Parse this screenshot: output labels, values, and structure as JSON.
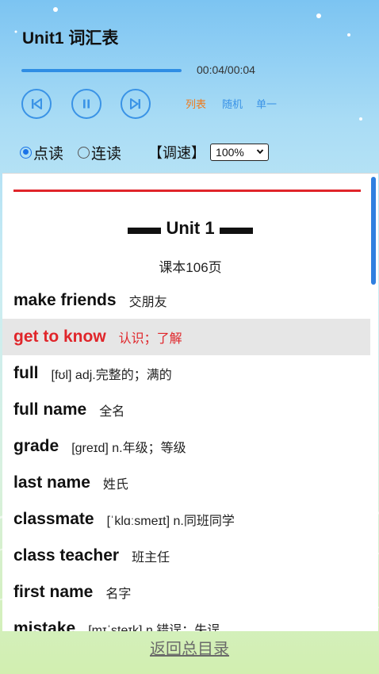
{
  "player": {
    "title": "Unit1 词汇表",
    "time": "00:04/00:04",
    "progress": 1.0,
    "modes": {
      "list": "列表",
      "random": "随机",
      "single": "单一"
    }
  },
  "read_options": {
    "point_read": "点读",
    "continuous_read": "连读",
    "speed_label": "【调速】",
    "speed_value": "100%"
  },
  "content": {
    "unit_title": "Unit 1",
    "page_ref": "课本106页",
    "words": [
      {
        "en": "make friends",
        "cn": "交朋友"
      },
      {
        "en": "get to know",
        "cn": "认识；了解",
        "active": true
      },
      {
        "en": "full",
        "cn": "[fʊl] adj.完整的；满的"
      },
      {
        "en": "full name",
        "cn": "全名"
      },
      {
        "en": "grade",
        "cn": "[ɡreɪd] n.年级；等级"
      },
      {
        "en": "last name",
        "cn": "姓氏"
      },
      {
        "en": "classmate",
        "cn": "[ˈklɑːsmeɪt] n.同班同学"
      },
      {
        "en": "class teacher",
        "cn": "班主任"
      },
      {
        "en": "first name",
        "cn": "名字"
      },
      {
        "en": "mistake",
        "cn": "[mɪˈsteɪk] n.错误；失误"
      }
    ]
  },
  "footer": {
    "back_label": "返回总目录"
  },
  "colors": {
    "accent_blue": "#3a93e6",
    "active_red": "#e0252a",
    "mode_orange": "#f07a1a"
  }
}
